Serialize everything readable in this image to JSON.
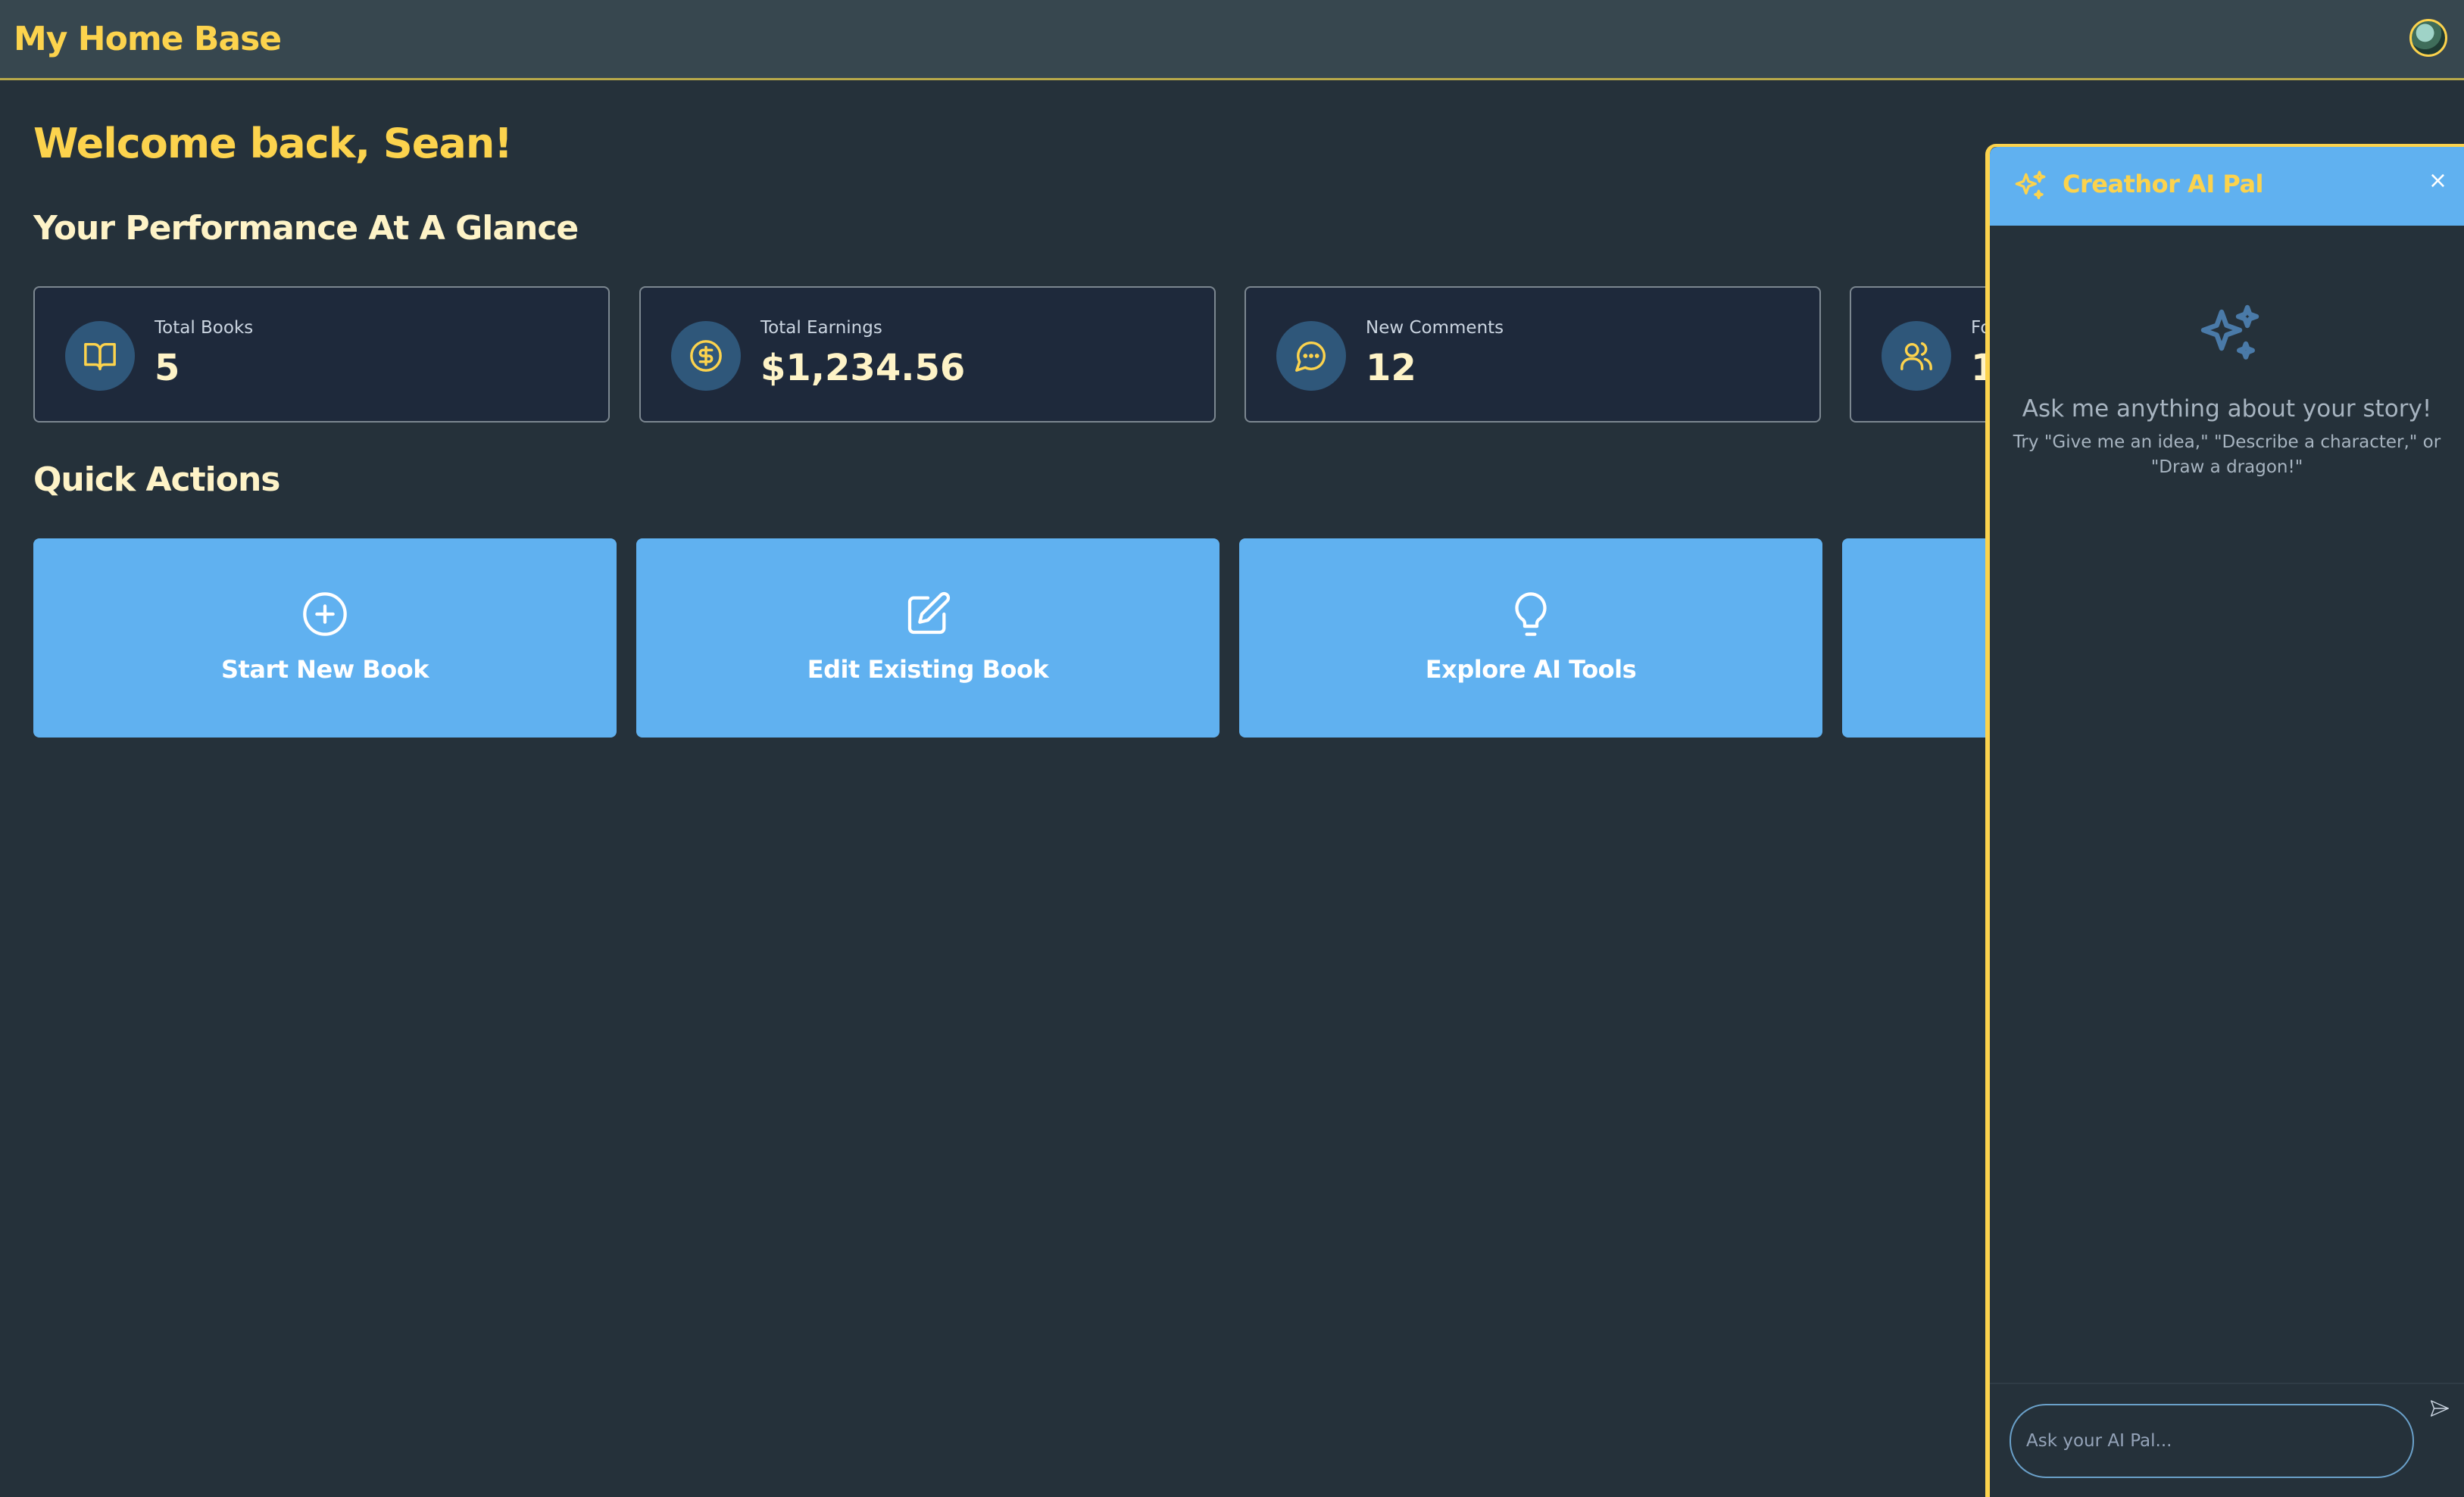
{
  "app": {
    "title": "My Home Base"
  },
  "welcome": "Welcome back, Sean!",
  "performance": {
    "title": "Your Performance At A Glance",
    "stats": [
      {
        "label": "Total Books",
        "value": "5",
        "icon": "book-open-icon"
      },
      {
        "label": "Total Earnings",
        "value": "$1,234.56",
        "icon": "dollar-circle-icon"
      },
      {
        "label": "New Comments",
        "value": "12",
        "icon": "message-circle-icon"
      },
      {
        "label": "Fo",
        "value": "1",
        "icon": "users-icon"
      }
    ]
  },
  "quick_actions": {
    "title": "Quick Actions",
    "items": [
      {
        "label": "Start New Book",
        "icon": "plus-circle-icon"
      },
      {
        "label": "Edit Existing Book",
        "icon": "edit-icon"
      },
      {
        "label": "Explore AI Tools",
        "icon": "lightbulb-icon"
      }
    ]
  },
  "ai_pal": {
    "title": "Creathor AI Pal",
    "close": "×",
    "empty_title": "Ask me anything about your story!",
    "empty_hint": "Try \"Give me an idea,\" \"Describe a character,\" or \"Draw a dragon!\"",
    "input_placeholder": "Ask your AI Pal..."
  },
  "colors": {
    "background": "#25313a",
    "topbar": "#37474f",
    "accent_yellow": "#fcd34d",
    "card_blue": "#60b1f0",
    "stat_card": "#1e293b"
  }
}
